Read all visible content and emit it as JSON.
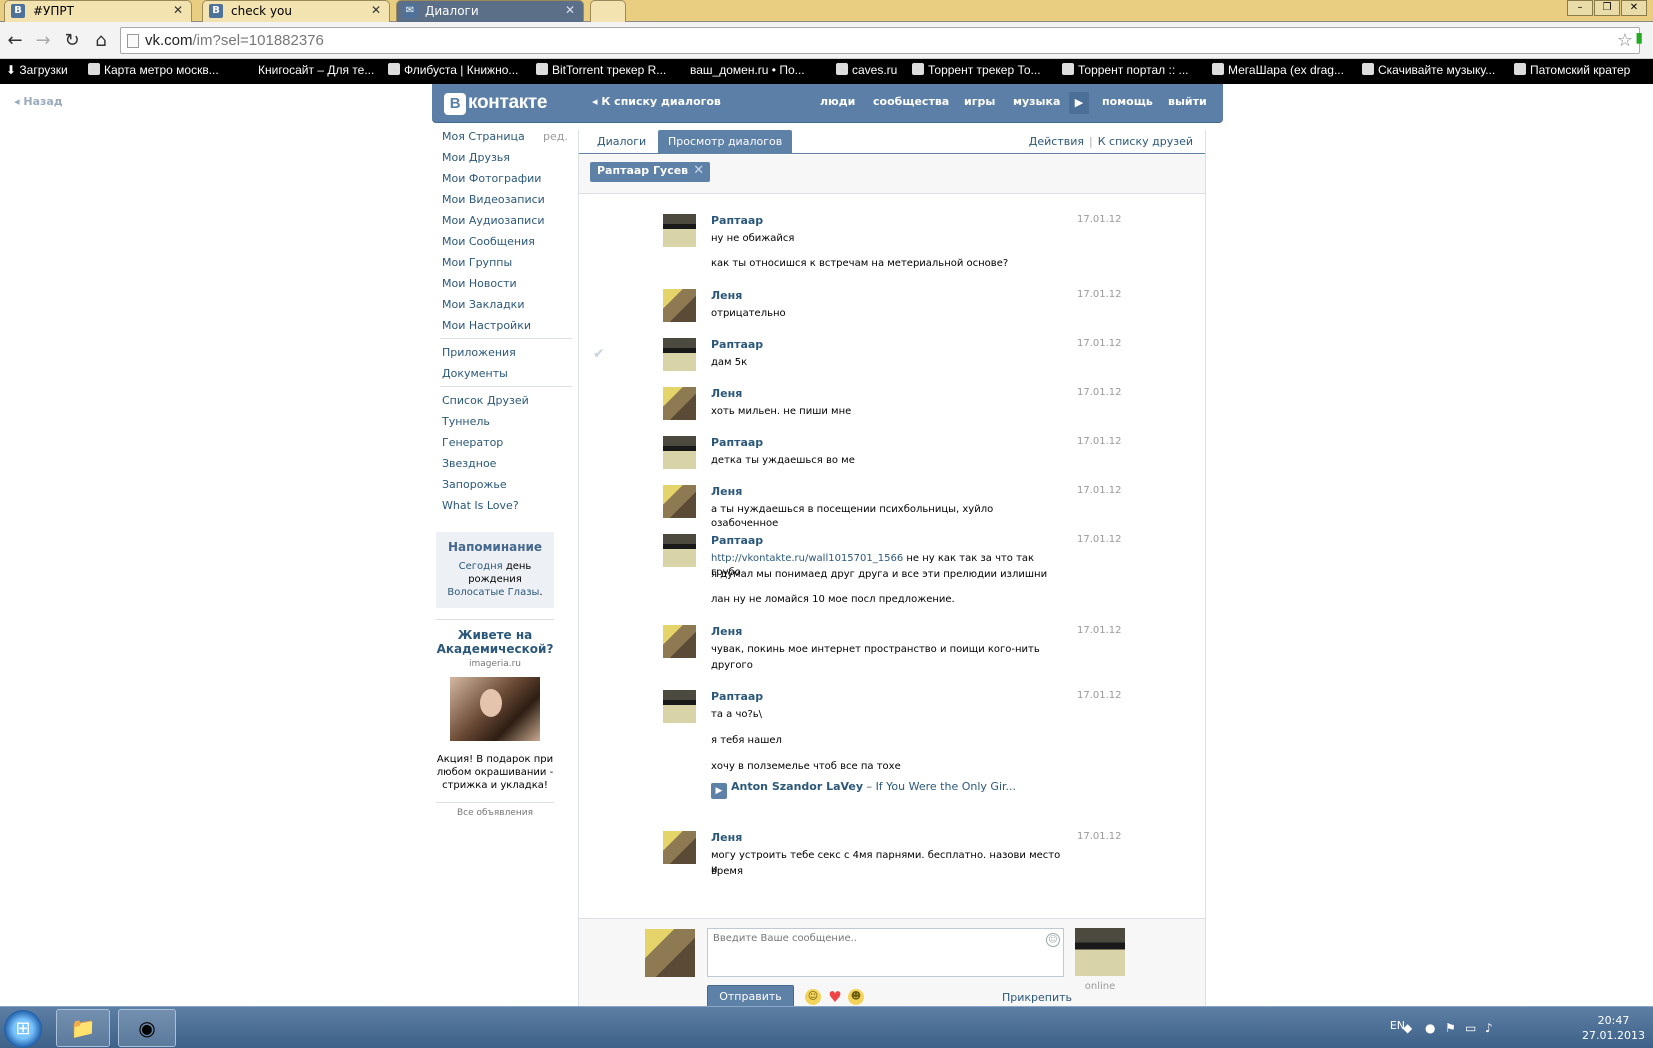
{
  "browser": {
    "tabs": [
      {
        "label": "#УПРТ",
        "favicon": "В"
      },
      {
        "label": "check you",
        "favicon": "В"
      },
      {
        "label": "Диалоги",
        "favicon": "✉"
      }
    ],
    "url_host": "vk.com",
    "url_path": "/im?sel=101882376",
    "bookmarks": [
      "Загрузки",
      "Карта метро москв...",
      "Книгосайт – Для те...",
      "Флибуста | Книжно...",
      "BitTorrent трекер R...",
      "ваш_домен.ru • По...",
      "caves.ru",
      "Торрент трекер То...",
      "Торрент портал :: ...",
      "МегаШара (ex drag...",
      "Скачивайте музыку...",
      "Патомский кратер"
    ]
  },
  "back_link": "Назад",
  "header": {
    "logo": "контакте",
    "logo_letter": "В",
    "to_list": "К списку диалогов",
    "nav": [
      "люди",
      "сообщества",
      "игры",
      "музыка",
      "помощь",
      "выйти"
    ]
  },
  "left_menu": {
    "edit": "ред.",
    "group1": [
      "Моя Страница",
      "Мои Друзья",
      "Мои Фотографии",
      "Мои Видеозаписи",
      "Мои Аудиозаписи",
      "Мои Сообщения",
      "Мои Группы",
      "Мои Новости",
      "Мои Закладки",
      "Мои Настройки"
    ],
    "group2": [
      "Приложения",
      "Документы"
    ],
    "group3": [
      "Список Друзей",
      "Туннель",
      "Генератор",
      "Звездное",
      "Запорожье",
      "What Is Love?"
    ]
  },
  "reminder": {
    "title": "Напоминание",
    "line1_link": "Сегодня",
    "line1_rest": " день рождения",
    "line2_link": "Волосатые Глазы",
    "line2_rest": "."
  },
  "ad": {
    "title": "Живете на Академической?",
    "domain": "imageria.ru",
    "text": "Акция! В подарок при любом окрашивании - стрижка и укладка!",
    "all_ads": "Все объявления"
  },
  "dialog": {
    "tabs": [
      "Диалоги",
      "Просмотр диалогов"
    ],
    "actions": "Действия",
    "to_friends": "К списку друзей",
    "filter_chip": "Раптаар Гусев",
    "messages": [
      {
        "author": "Раптаар",
        "date": "17.01.12",
        "lines": [
          "ну не обижайся",
          "как ты относишся к встречам на метериальной основе?"
        ]
      },
      {
        "author": "Леня",
        "date": "17.01.12",
        "lines": [
          "отрицательно"
        ]
      },
      {
        "author": "Раптаар",
        "date": "17.01.12",
        "lines": [
          "дам 5к"
        ]
      },
      {
        "author": "Леня",
        "date": "17.01.12",
        "lines": [
          "хоть мильен. не пиши мне"
        ]
      },
      {
        "author": "Раптаар",
        "date": "17.01.12",
        "lines": [
          "детка ты уждаешься во ме"
        ]
      },
      {
        "author": "Леня",
        "date": "17.01.12",
        "lines": [
          "а ты нуждаешься в посещении психбольницы, хуйло озабоченное"
        ]
      },
      {
        "author": "Раптаар",
        "date": "17.01.12",
        "link": "http://vkontakte.ru/wall1015701_1566",
        "lines": [
          " не ну как так за что так грубо",
          "я думал мы понимаед друг друга и все эти прелюдии излишни",
          "лан ну не ломайся 10 мое посл предложение."
        ]
      },
      {
        "author": "Леня",
        "date": "17.01.12",
        "lines": [
          "чувак, покинь мое интернет пространство и поищи кого-нить",
          "другого"
        ]
      },
      {
        "author": "Раптаар",
        "date": "17.01.12",
        "lines": [
          "та а чо?ь\\",
          "я тебя нашел",
          "хочу в полземелье чтоб все па тохе"
        ],
        "audio_artist": "Anton Szandor LaVey",
        "audio_sep": " – ",
        "audio_title": "If You Were the Only Gir..."
      },
      {
        "author": "Леня",
        "date": "17.01.12",
        "lines": [
          "могу устроить тебе секс с 4мя парнями. бесплатно. назови место и",
          "время"
        ]
      }
    ],
    "composer": {
      "placeholder": "Введите Ваше сообщение..",
      "send": "Отправить",
      "attach": "Прикрепить",
      "online": "online"
    }
  },
  "taskbar": {
    "lang": "EN",
    "time": "20:47",
    "date": "27.01.2013"
  }
}
